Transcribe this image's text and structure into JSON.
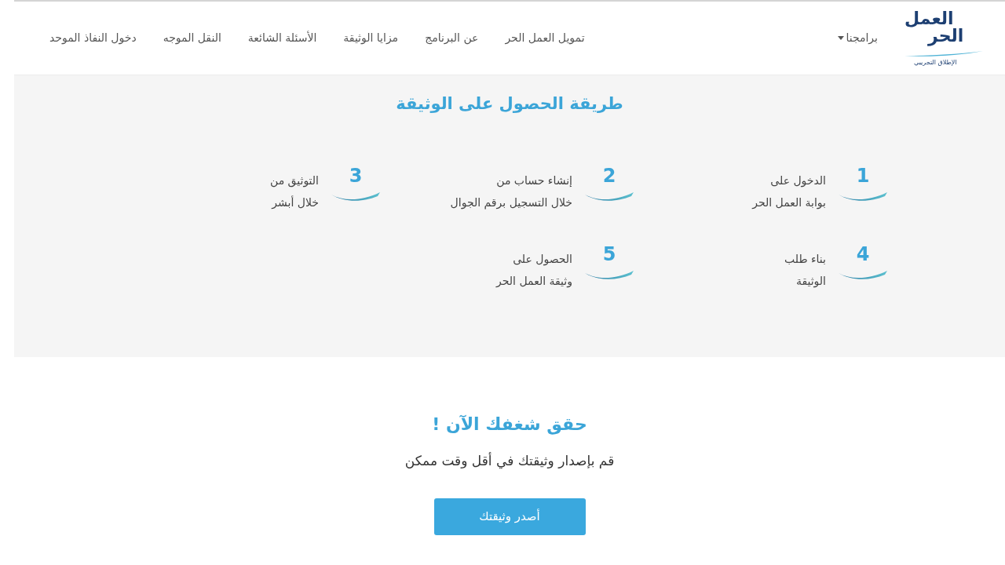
{
  "header": {
    "logo": {
      "title_line_1": "العمل",
      "title_line_2": "الحر",
      "tagline": "الإطلاق التجريبي"
    },
    "programs_menu": {
      "label": "برامجنا"
    },
    "nav_links": [
      "تمويل العمل الحر",
      "عن البرنامج",
      "مزايا الوثيقة",
      "الأسئلة الشائعة",
      "النقل الموجه",
      "دخول النفاذ الموحد"
    ]
  },
  "steps_section": {
    "title": "طريقة الحصول على الوثيقة",
    "steps": [
      {
        "number": "1",
        "lines": [
          "الدخول على",
          "بوابة العمل الحر"
        ]
      },
      {
        "number": "2",
        "lines": [
          "إنشاء حساب من",
          "خلال التسجيل برقم الجوال"
        ]
      },
      {
        "number": "3",
        "lines": [
          "التوثيق من",
          "خلال أبشر"
        ]
      },
      {
        "number": "4",
        "lines": [
          "بناء طلب",
          "الوثيقة"
        ]
      },
      {
        "number": "5",
        "lines": [
          "الحصول على",
          "وثيقة العمل الحر"
        ]
      }
    ]
  },
  "cta_section": {
    "title": "حقق شغفك الآن !",
    "subtitle": "قم بإصدار وثيقتك في أقل وقت ممكن",
    "button": "أصدر وثيقتك"
  }
}
